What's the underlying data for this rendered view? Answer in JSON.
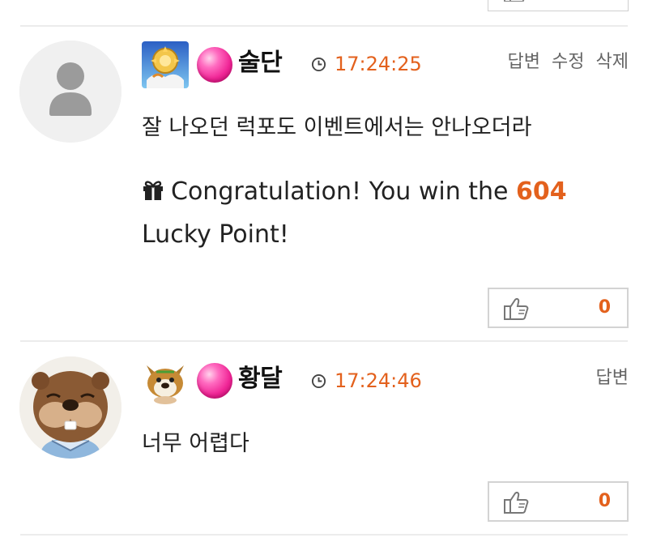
{
  "comments": [
    {
      "nickname": "술단",
      "time": "17:24:25",
      "actions": [
        "답변",
        "수정",
        "삭제"
      ],
      "content": "잘 나오던 럭포도 이벤트에서는 안나오더라",
      "lucky": {
        "before": "Congratulation! You win the ",
        "points": "604",
        "after": " Lucky Point!"
      },
      "likes": "0",
      "avatar_icon": "default-user-icon",
      "level_icon": "golden-emblem-icon"
    },
    {
      "nickname": "황달",
      "time": "17:24:46",
      "actions": [
        "답변"
      ],
      "content": "너무 어렵다",
      "likes": "0",
      "avatar_icon": "beaver-character-icon",
      "level_icon": "dog-character-icon"
    }
  ],
  "colors": {
    "accent": "#e3611d",
    "badge": "#f02596",
    "divider": "#ececec"
  }
}
